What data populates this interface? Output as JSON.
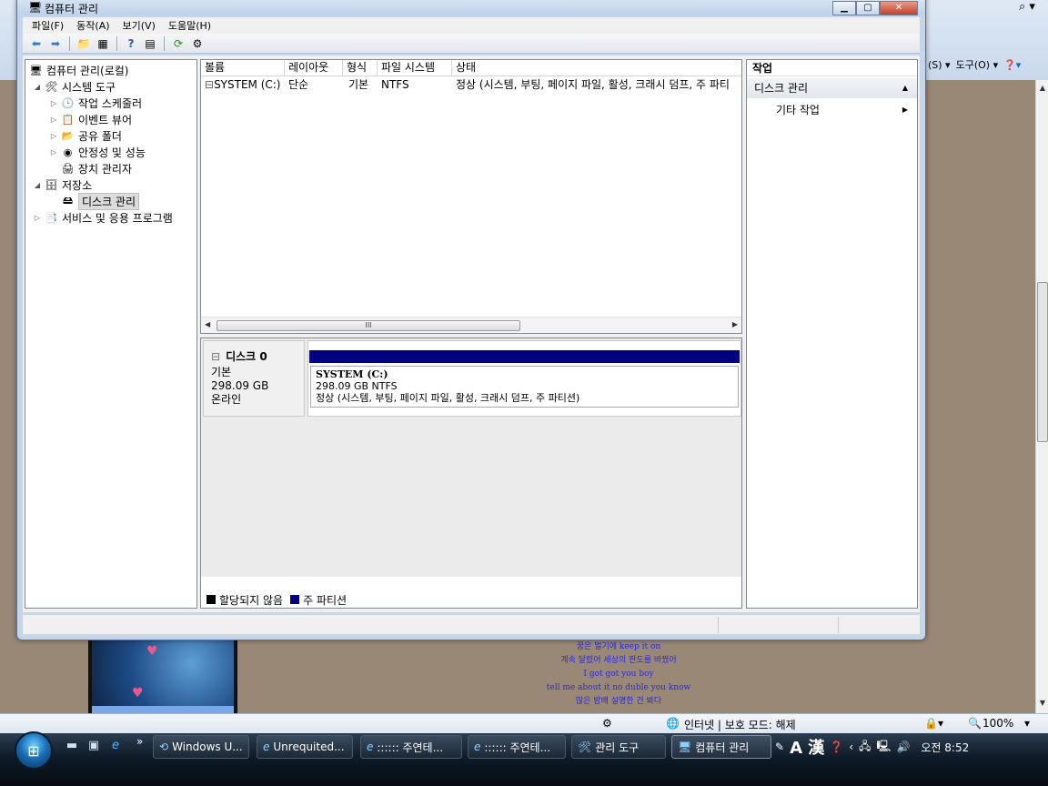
{
  "window": {
    "title": "컴퓨터 관리",
    "menus": [
      "파일(F)",
      "동작(A)",
      "보기(V)",
      "도움말(H)"
    ]
  },
  "toolbar": {
    "icons": [
      "back-icon",
      "forward-icon",
      "up-folder-icon",
      "show-hide-tree-icon",
      "help-icon",
      "properties-icon",
      "refresh-icon",
      "settings-icon"
    ]
  },
  "tree": {
    "root": "컴퓨터 관리(로컬)",
    "system_tools": "시스템 도구",
    "task_scheduler": "작업 스케줄러",
    "event_viewer": "이벤트 뷰어",
    "shared_folders": "공유 폴더",
    "reliability": "안정성 및 성능",
    "device_manager": "장치 관리자",
    "storage": "저장소",
    "disk_management": "디스크 관리",
    "services": "서비스 및 응용 프로그램"
  },
  "volume_list": {
    "columns": [
      "볼륨",
      "레이아웃",
      "형식",
      "파일 시스템",
      "상태"
    ],
    "rows": [
      {
        "volume": "SYSTEM (C:)",
        "layout": "단순",
        "type": "기본",
        "fs": "NTFS",
        "status": "정상 (시스템, 부팅, 페이지 파일, 활성, 크래시 덤프, 주 파티"
      }
    ],
    "scroll_grip": "III"
  },
  "disk": {
    "name": "디스크 0",
    "type": "기본",
    "size": "298.09 GB",
    "state": "온라인",
    "partition_name": "SYSTEM  (C:)",
    "partition_size": "298.09 GB NTFS",
    "partition_status": "정상 (시스템, 부팅, 페이지 파일, 활성, 크래시 덤프, 주 파티션)",
    "legend_unallocated": "할당되지 않음",
    "legend_primary": "주 파티션",
    "primary_color": "#000080",
    "unallocated_color": "#000000"
  },
  "actions": {
    "header": "작업",
    "section": "디스크 관리",
    "more": "기타 작업"
  },
  "ie": {
    "page_menu": "(S) ▾",
    "tools_menu": "도구(O) ▾",
    "lyrics": [
      "꿈은 멀기에 keep it on",
      "계속 달렸어 세상의 판도를 바꿨어",
      "I got got you boy",
      "tell me about it no duble you know",
      "많은 밤배 설명한 건 봐다"
    ],
    "status_zone": "인터넷 | 보호 모드: 해제",
    "zoom": "100%"
  },
  "taskbar": {
    "tasks": [
      "Windows U...",
      "Unrequited...",
      ":::::: 주연테...",
      ":::::: 주연테...",
      "관리 도구",
      "컴퓨터 관리"
    ],
    "lang": "A 漢",
    "clock": "오전 8:52"
  }
}
